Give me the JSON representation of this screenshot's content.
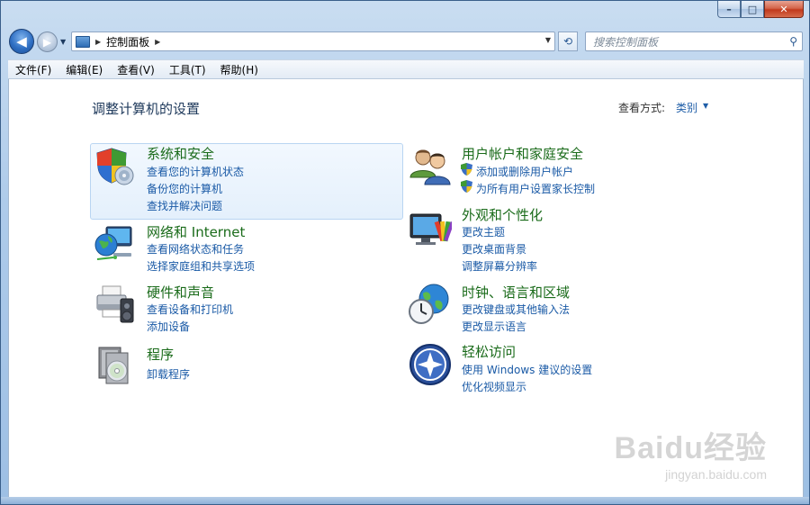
{
  "window": {
    "caption_buttons": {
      "minimize": "–",
      "maximize": "□",
      "close": "✕"
    }
  },
  "navbar": {
    "address_path": "控制面板",
    "search_placeholder": "搜索控制面板"
  },
  "menu": [
    "文件(F)",
    "编辑(E)",
    "查看(V)",
    "工具(T)",
    "帮助(H)"
  ],
  "content": {
    "page_title": "调整计算机的设置",
    "view_by_label": "查看方式:",
    "view_by_value": "类别"
  },
  "categories": [
    {
      "title": "系统和安全",
      "icon": "security-shield-icon",
      "links": [
        "查看您的计算机状态",
        "备份您的计算机",
        "查找并解决问题"
      ]
    },
    {
      "title": "网络和 Internet",
      "icon": "network-globe-icon",
      "links": [
        "查看网络状态和任务",
        "选择家庭组和共享选项"
      ]
    },
    {
      "title": "硬件和声音",
      "icon": "printer-speaker-icon",
      "links": [
        "查看设备和打印机",
        "添加设备"
      ]
    },
    {
      "title": "程序",
      "icon": "programs-disc-icon",
      "links": [
        "卸载程序"
      ]
    },
    {
      "title": "用户帐户和家庭安全",
      "icon": "users-icon",
      "links": [
        "添加或删除用户帐户",
        "为所有用户设置家长控制"
      ]
    },
    {
      "title": "外观和个性化",
      "icon": "monitor-palette-icon",
      "links": [
        "更改主题",
        "更改桌面背景",
        "调整屏幕分辨率"
      ]
    },
    {
      "title": "时钟、语言和区域",
      "icon": "clock-globe-icon",
      "links": [
        "更改键盘或其他输入法",
        "更改显示语言"
      ]
    },
    {
      "title": "轻松访问",
      "icon": "ease-of-access-icon",
      "links": [
        "使用 Windows 建议的设置",
        "优化视频显示"
      ]
    }
  ],
  "watermark": {
    "brand": "Baidu经验",
    "url": "jingyan.baidu.com"
  }
}
